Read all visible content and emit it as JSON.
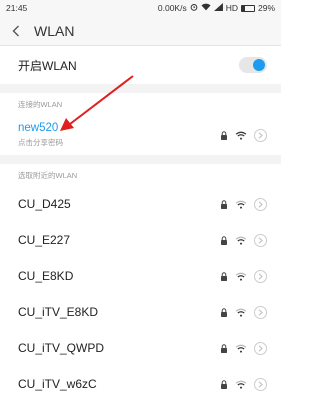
{
  "status": {
    "time": "21:45",
    "speed": "0.00K/s",
    "network": "HD",
    "battery": "29%",
    "battery_level": 0.29
  },
  "header": {
    "title": "WLAN"
  },
  "wlan_toggle": {
    "label": "开启WLAN",
    "on": true
  },
  "connected_section": {
    "header": "连接的WLAN",
    "network": {
      "name": "new520",
      "subtitle": "点击分享密码"
    }
  },
  "nearby_section": {
    "header": "选取附近的WLAN",
    "networks": [
      {
        "name": "CU_D425"
      },
      {
        "name": "CU_E227"
      },
      {
        "name": "CU_E8KD"
      },
      {
        "name": "CU_iTV_E8KD"
      },
      {
        "name": "CU_iTV_QWPD"
      },
      {
        "name": "CU_iTV_w6zC"
      }
    ]
  },
  "colors": {
    "accent": "#1d9bf0",
    "annotation_arrow": "#e02020"
  }
}
